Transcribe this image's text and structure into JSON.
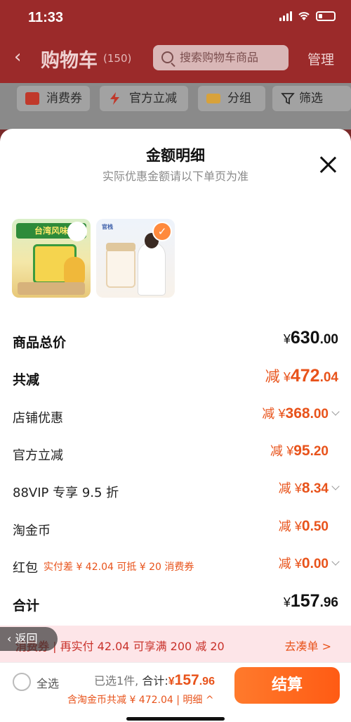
{
  "status_bar": {
    "time": "11:33"
  },
  "nav": {
    "title": "购物车",
    "count": "(150)",
    "search_placeholder": "搜索购物车商品",
    "manage_label": "管理"
  },
  "filters": [
    {
      "label": "消费券",
      "icon": "coupon-icon"
    },
    {
      "label": "官方立减",
      "icon": "lightning-icon"
    },
    {
      "label": "分组",
      "icon": "folder-icon"
    },
    {
      "label": "筛选",
      "icon": "funnel-icon"
    }
  ],
  "sheet": {
    "title": "金额明细",
    "subtitle": "实际优惠金额请以下单页为准",
    "thumbnails": [
      {
        "banner": "台湾风味",
        "name": "pineapple-cake-thumbnail"
      },
      {
        "brand": "官栈",
        "name": "fish-maw-jar-thumbnail",
        "selected": true
      }
    ],
    "rows": {
      "total": {
        "label": "商品总价",
        "currency": "¥",
        "int": "630",
        "dec": ".00"
      },
      "reduce": {
        "label": "共减",
        "prefix": "减",
        "currency": "¥",
        "int": "472",
        "dec": ".04"
      },
      "shop": {
        "label": "店铺优惠",
        "prefix": "减",
        "currency": "¥",
        "int": "368",
        "dec": ".00"
      },
      "official": {
        "label": "官方立减",
        "prefix": "减",
        "currency": "¥",
        "int": "95",
        "dec": ".20"
      },
      "vip": {
        "label": "88VIP 专享 9.5 折",
        "prefix": "减",
        "currency": "¥",
        "int": "8",
        "dec": ".34"
      },
      "coins": {
        "label": "淘金币",
        "prefix": "减",
        "currency": "¥",
        "int": "0",
        "dec": ".50"
      },
      "redpacket": {
        "label": "红包",
        "note": "实付差 ¥ 42.04 可抵 ¥ 20 消费券",
        "prefix": "减",
        "currency": "¥",
        "int": "0",
        "dec": ".00"
      },
      "sum": {
        "label": "合计",
        "currency": "¥",
        "int": "157",
        "dec": ".96"
      }
    }
  },
  "promo": {
    "tag": "消费券",
    "text": "| 再实付 42.04 可享满 200 减 20",
    "link": "去凑单 >",
    "back_label": "返回"
  },
  "bottom": {
    "select_all": "全选",
    "selected": "已选1件, ",
    "total_label": "合计:",
    "currency": "¥",
    "total_int": "157",
    "total_dec": ".96",
    "sub_text": "含淘金币共减 ¥ 472.04",
    "detail": "明细 ^",
    "checkout": "结算"
  },
  "colors": {
    "accent": "#e8531b",
    "header": "#9b2a2a",
    "checkout": "#ff5b14"
  }
}
